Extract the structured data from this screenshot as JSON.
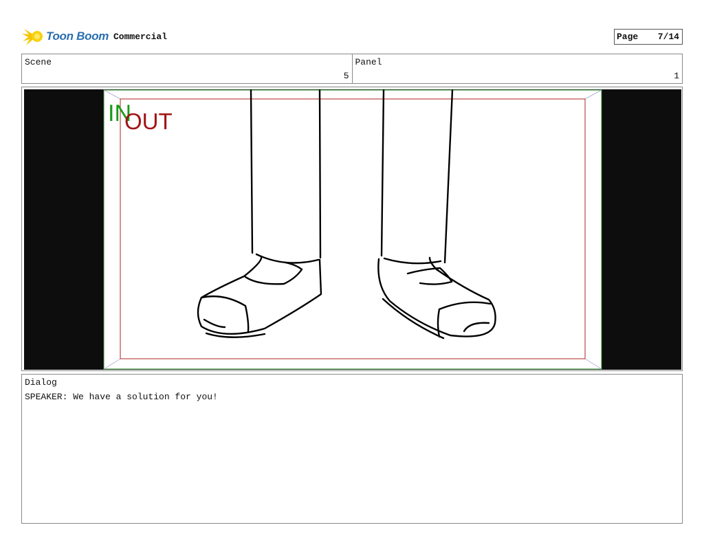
{
  "header": {
    "logo_text": "Toon Boom",
    "project": "Commercial",
    "page_label": "Page",
    "page_value": "7/14"
  },
  "info": {
    "scene_label": "Scene",
    "scene_value": "5",
    "panel_label": "Panel",
    "panel_value": "1"
  },
  "panel": {
    "in_label": "IN",
    "out_label": "OUT",
    "in_color": "#1a9a1a",
    "out_color": "#a01515",
    "background": "#0d0d0d"
  },
  "dialog": {
    "label": "Dialog",
    "text": "SPEAKER: We have a solution for you!"
  }
}
